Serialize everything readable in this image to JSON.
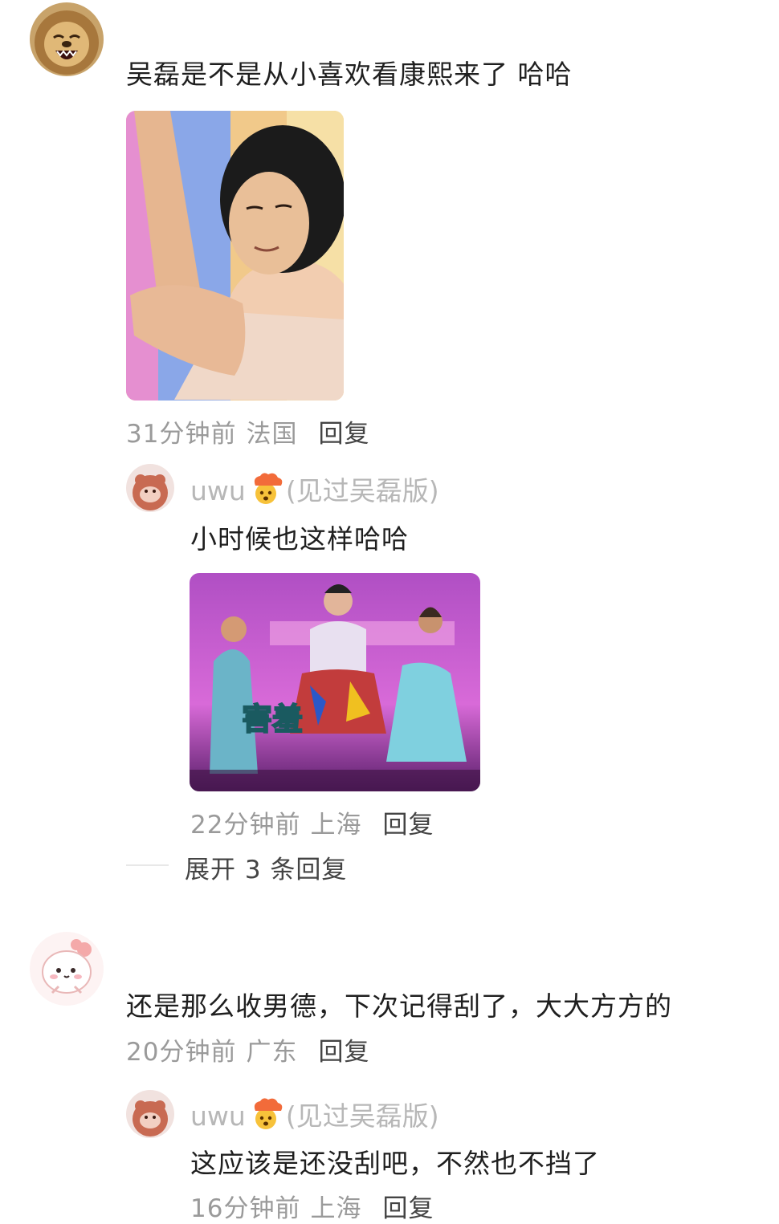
{
  "comments": [
    {
      "text": "吴磊是不是从小喜欢看康熙来了 哈哈",
      "time": "31分钟前",
      "location": "法国",
      "reply_label": "回复",
      "replies": [
        {
          "username": "uwu",
          "badge": "(见过吴磊版)",
          "text": "小时候也这样哈哈",
          "image_caption": "害羞",
          "time": "22分钟前",
          "location": "上海",
          "reply_label": "回复"
        }
      ],
      "expand_label": "展开 3 条回复"
    },
    {
      "text": "还是那么收男德，下次记得刮了，大大方方的",
      "time": "20分钟前",
      "location": "广东",
      "reply_label": "回复",
      "replies": [
        {
          "username": "uwu",
          "badge": "(见过吴磊版)",
          "text": "这应该是还没刮吧，不然也不挡了",
          "time": "16分钟前",
          "location": "上海",
          "reply_label": "回复"
        }
      ]
    }
  ],
  "icons": {
    "reply_user_emoji": "exploding-head-icon"
  },
  "colors": {
    "meta_text": "#9a9a9a",
    "username": "#b7b7b7",
    "main_text": "#1f1f1f"
  }
}
